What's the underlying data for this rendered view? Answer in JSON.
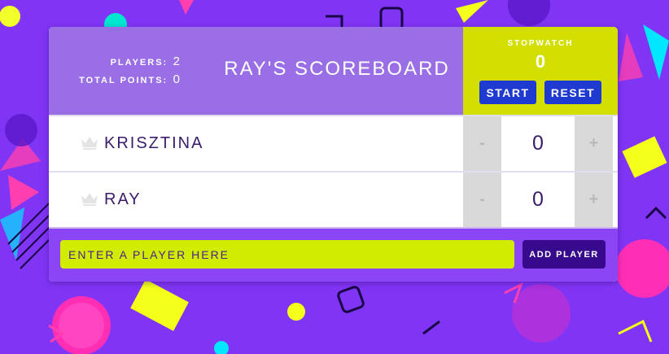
{
  "header": {
    "title": "RAY'S SCOREBOARD",
    "players_label": "PLAYERS:",
    "players_value": "2",
    "points_label": "TOTAL POINTS:",
    "points_value": "0"
  },
  "stopwatch": {
    "label": "STOPWATCH",
    "time": "0",
    "start_label": "START",
    "reset_label": "RESET"
  },
  "players": [
    {
      "name": "KRISZTINA",
      "score": "0",
      "decrement": "-",
      "increment": "+",
      "icon": "crown-icon"
    },
    {
      "name": "RAY",
      "score": "0",
      "decrement": "-",
      "increment": "+",
      "icon": "crown-icon"
    }
  ],
  "add_player": {
    "placeholder": "ENTER A PLAYER HERE",
    "value": "",
    "button_label": "ADD PLAYER"
  },
  "colors": {
    "background": "#8035f4",
    "header": "#9a6ee4",
    "stopwatch": "#d2df00",
    "blue_button": "#1f3ad1",
    "input": "#d2ec00",
    "add_button": "#37098c",
    "text_dark": "#3a1c6c"
  }
}
